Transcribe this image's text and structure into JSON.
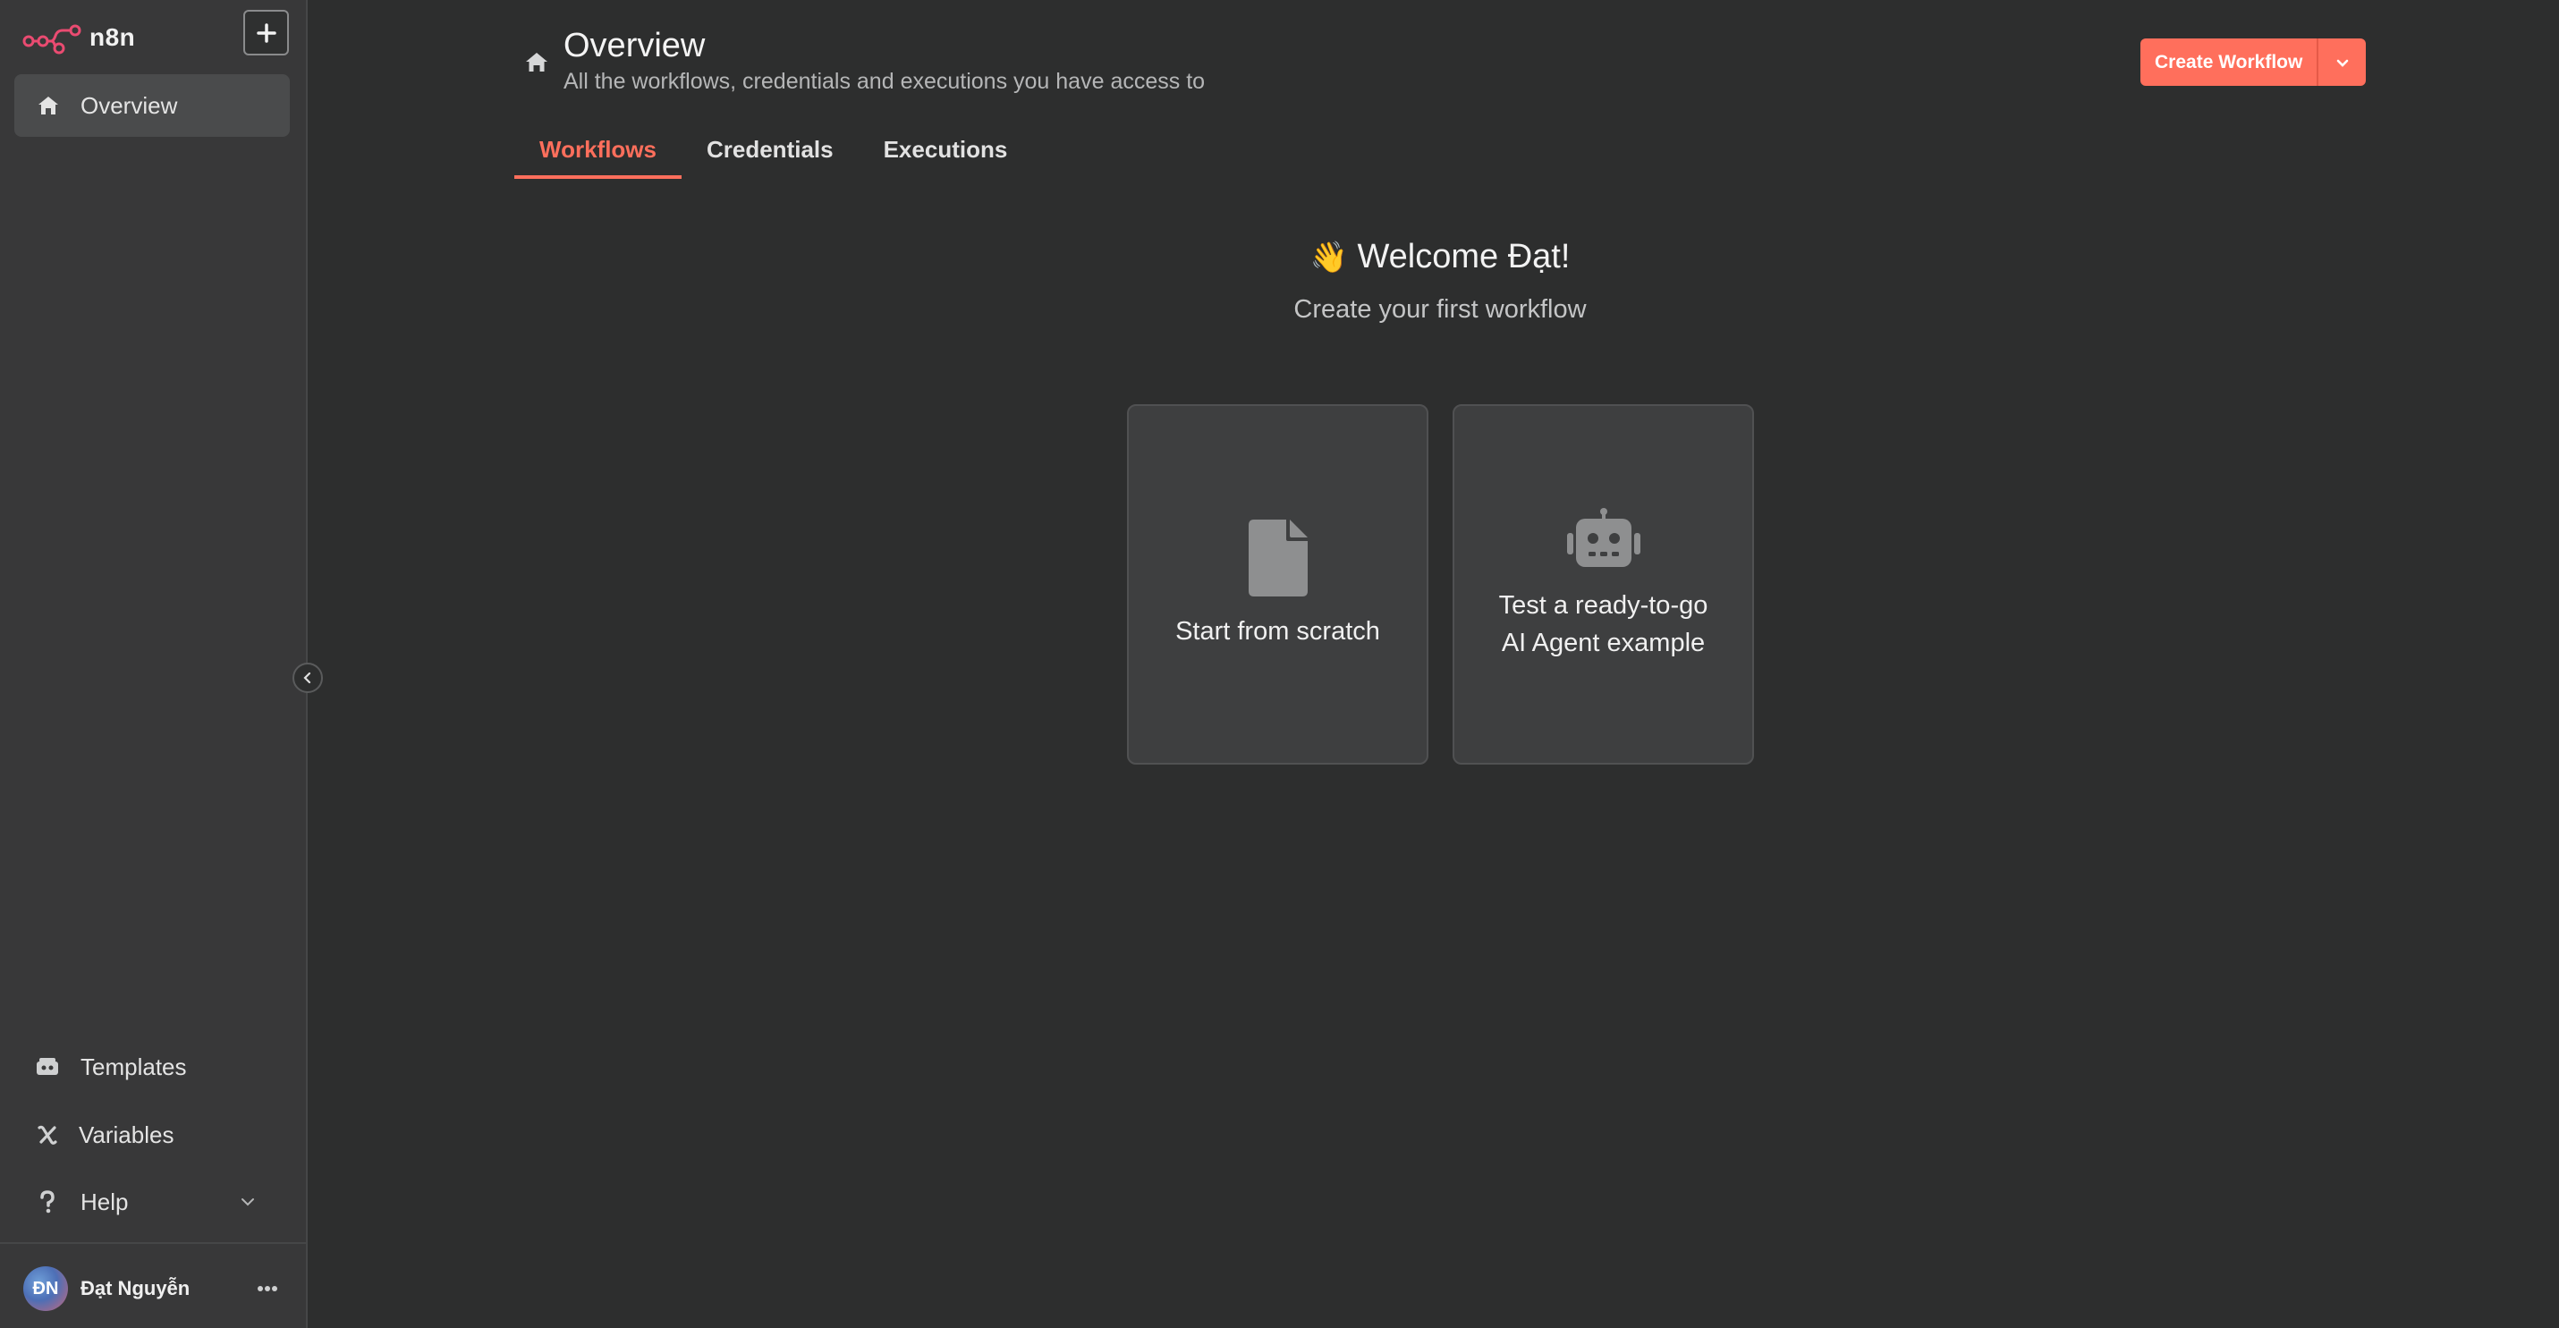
{
  "sidebar": {
    "logo_text": "n8n",
    "nav": {
      "overview_label": "Overview"
    },
    "bottom_items": [
      {
        "label": "Templates",
        "icon": "templates-icon"
      },
      {
        "label": "Variables",
        "icon": "variables-icon"
      },
      {
        "label": "Help",
        "icon": "help-icon"
      }
    ],
    "user": {
      "initials": "ĐN",
      "name": "Đạt Nguyễn"
    }
  },
  "header": {
    "title": "Overview",
    "subtitle": "All the workflows, credentials and executions you have access to",
    "create_button": "Create Workflow"
  },
  "tabs": [
    {
      "label": "Workflows",
      "active": true
    },
    {
      "label": "Credentials",
      "active": false
    },
    {
      "label": "Executions",
      "active": false
    }
  ],
  "welcome": {
    "emoji": "👋",
    "title": "Welcome Đạt!",
    "subtitle": "Create your first workflow"
  },
  "cards": [
    {
      "line1": "Start from scratch",
      "icon": "file-icon"
    },
    {
      "line1": "Test a ready-to-go",
      "line2": "AI Agent example",
      "icon": "robot-icon"
    }
  ],
  "colors": {
    "accent": "#ff6f5c",
    "background": "#2d2e2e",
    "sidebar": "#383839",
    "logo": "#ea4b71"
  }
}
